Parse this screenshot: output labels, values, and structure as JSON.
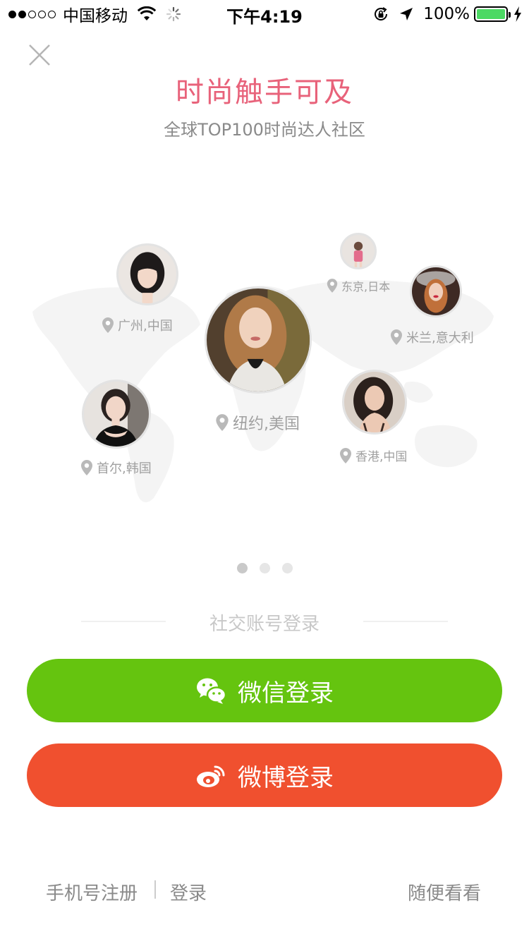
{
  "status_bar": {
    "carrier": "中国移动",
    "time": "下午4:19",
    "battery": "100%",
    "battery_level": 1.0,
    "signal_bars": 2
  },
  "header": {
    "close_icon": "close-icon",
    "title": "时尚触手可及",
    "subtitle": "全球TOP100时尚达人社区"
  },
  "map": {
    "people": [
      {
        "location": "广州,中国"
      },
      {
        "location": "东京,日本"
      },
      {
        "location": "米兰,意大利"
      },
      {
        "location": "纽约,美国"
      },
      {
        "location": "首尔,韩国"
      },
      {
        "location": "香港,中国"
      }
    ]
  },
  "pager": {
    "count": 3,
    "active": 0
  },
  "social": {
    "divider_label": "社交账号登录",
    "wechat_label": "微信登录",
    "weibo_label": "微博登录",
    "wechat_icon": "wechat-icon",
    "weibo_icon": "weibo-icon"
  },
  "footer": {
    "register": "手机号注册",
    "login": "登录",
    "browse": "随便看看"
  },
  "colors": {
    "title": "#e8627a",
    "wechat": "#65c40f",
    "weibo": "#f0502f",
    "battery": "#4cd964"
  }
}
